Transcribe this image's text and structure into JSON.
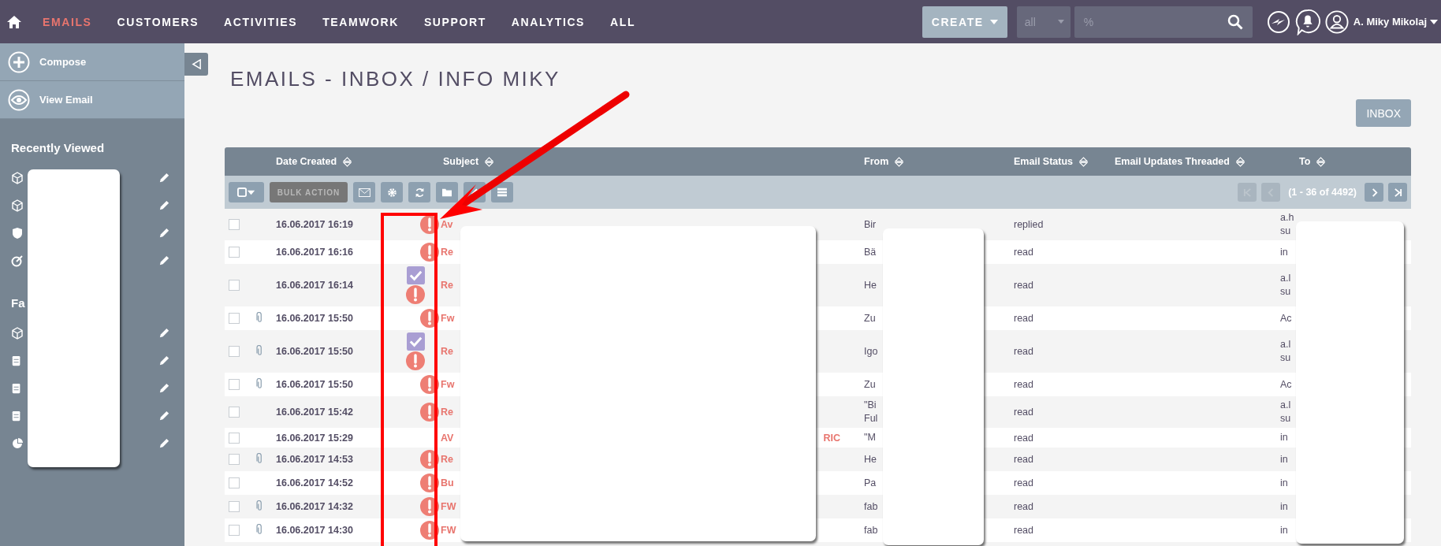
{
  "nav": {
    "items": [
      {
        "label": "EMAILS",
        "selected": true
      },
      {
        "label": "CUSTOMERS",
        "selected": false
      },
      {
        "label": "ACTIVITIES",
        "selected": false
      },
      {
        "label": "TEAMWORK",
        "selected": false
      },
      {
        "label": "SUPPORT",
        "selected": false
      },
      {
        "label": "ANALYTICS",
        "selected": false
      },
      {
        "label": "ALL",
        "selected": false
      }
    ],
    "create": "CREATE",
    "filter": "all",
    "search": {
      "value": "%"
    },
    "user": "A. Miky Mikolaj"
  },
  "sidebar": {
    "actions": [
      {
        "kind": "plus",
        "label": "Compose"
      },
      {
        "kind": "eye",
        "label": "View Email"
      }
    ],
    "recent_heading": "Recently Viewed",
    "recent": [
      {
        "kind": "cube"
      },
      {
        "kind": "cube"
      },
      {
        "kind": "shield"
      },
      {
        "kind": "target"
      }
    ],
    "favorites_heading": "Fa",
    "favorites": [
      {
        "kind": "cube"
      },
      {
        "kind": "doc"
      },
      {
        "kind": "doc"
      },
      {
        "kind": "doc"
      },
      {
        "kind": "pie"
      }
    ]
  },
  "title": "EMAILS - INBOX / INFO MIKY",
  "folder_button": "INBOX",
  "table": {
    "columns": [
      "Date Created",
      "Subject",
      "From",
      "Email Status",
      "Email Updates Threaded",
      "To"
    ],
    "bulk_action": "BULK ACTION",
    "pagination": "(1 - 36 of 4492)",
    "rows": [
      {
        "checked": false,
        "attachment": false,
        "date": "16.06.2017 16:19",
        "check_badge": false,
        "alert": true,
        "subject": "Av",
        "from": [
          "Bir"
        ],
        "status": "replied",
        "to": [
          "a.h",
          "su"
        ]
      },
      {
        "checked": false,
        "attachment": false,
        "date": "16.06.2017 16:16",
        "check_badge": false,
        "alert": true,
        "subject": "Re",
        "from": [
          "Bä"
        ],
        "status": "read",
        "to": [
          "in"
        ]
      },
      {
        "checked": false,
        "attachment": false,
        "date": "16.06.2017 16:14",
        "check_badge": true,
        "alert": true,
        "subject": "Re",
        "from": [
          "He"
        ],
        "status": "read",
        "to": [
          "a.l",
          "su"
        ]
      },
      {
        "checked": false,
        "attachment": true,
        "date": "16.06.2017 15:50",
        "check_badge": false,
        "alert": true,
        "subject": "Fw",
        "from": [
          "Zu"
        ],
        "status": "read",
        "to": [
          "Ac"
        ]
      },
      {
        "checked": false,
        "attachment": true,
        "date": "16.06.2017 15:50",
        "check_badge": true,
        "alert": true,
        "subject": "Re",
        "from": [
          "Igo"
        ],
        "status": "read",
        "to": [
          "a.l",
          "su"
        ]
      },
      {
        "checked": false,
        "attachment": true,
        "date": "16.06.2017 15:50",
        "check_badge": false,
        "alert": true,
        "subject": "Fw",
        "from": [
          "Zu"
        ],
        "status": "read",
        "to": [
          "Ac"
        ]
      },
      {
        "checked": false,
        "attachment": false,
        "date": "16.06.2017 15:42",
        "check_badge": false,
        "alert": true,
        "subject": "Re",
        "from": [
          "\"Bi",
          "Ful"
        ],
        "status": "read",
        "to": [
          "a.l",
          "su"
        ]
      },
      {
        "checked": false,
        "attachment": false,
        "date": "16.06.2017 15:29",
        "check_badge": false,
        "alert": false,
        "subject": "AV",
        "subject_tail": "RIC",
        "from": [
          "\"M"
        ],
        "status": "read",
        "to": [
          "in"
        ]
      },
      {
        "checked": false,
        "attachment": true,
        "date": "16.06.2017 14:53",
        "check_badge": false,
        "alert": true,
        "subject": "Re",
        "from": [
          "He"
        ],
        "status": "read",
        "to": [
          "in"
        ]
      },
      {
        "checked": false,
        "attachment": false,
        "date": "16.06.2017 14:52",
        "check_badge": false,
        "alert": true,
        "subject": "Bu",
        "from": [
          "Pa"
        ],
        "status": "read",
        "to": [
          "in"
        ]
      },
      {
        "checked": false,
        "attachment": true,
        "date": "16.06.2017 14:32",
        "check_badge": false,
        "alert": true,
        "subject": "FW",
        "from": [
          "fab"
        ],
        "status": "read",
        "to": [
          "in"
        ]
      },
      {
        "checked": false,
        "attachment": true,
        "date": "16.06.2017 14:30",
        "check_badge": false,
        "alert": true,
        "subject": "FW",
        "from": [
          "fab"
        ],
        "status": "read",
        "to": [
          "in"
        ]
      }
    ]
  }
}
